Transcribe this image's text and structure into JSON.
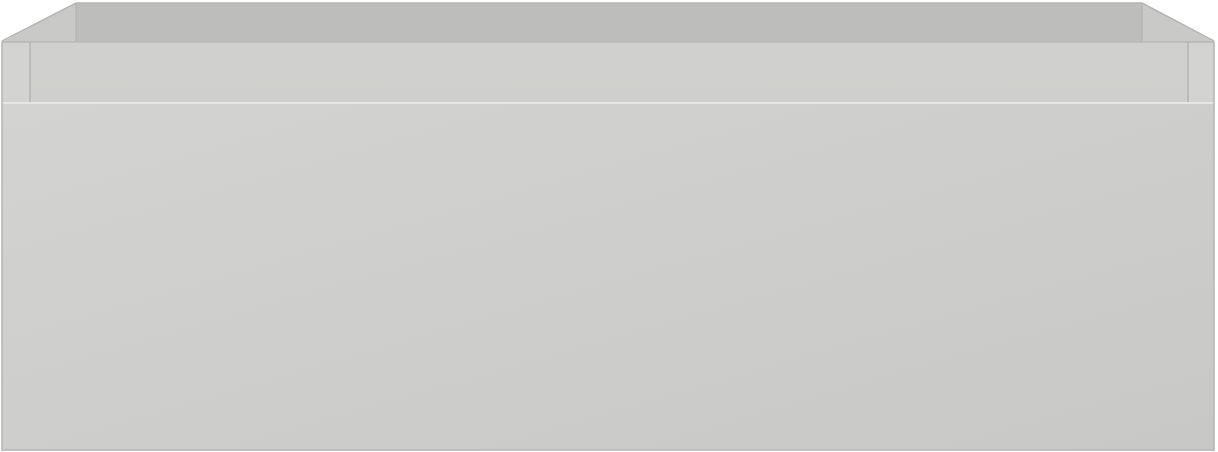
{
  "image": {
    "subject": "drawer-unit",
    "colors": {
      "background": "#ffffff",
      "front_light": "#d3d3d1",
      "front_dark": "#c8c8c6",
      "rim_top": "#d0d0ce",
      "rim_bottom": "#cacac8",
      "inner_wall": "#bdbdbb",
      "inner_side": "#c9c9c7",
      "edge": "#b4b4b2",
      "highlight": "#e6e6e4"
    }
  }
}
